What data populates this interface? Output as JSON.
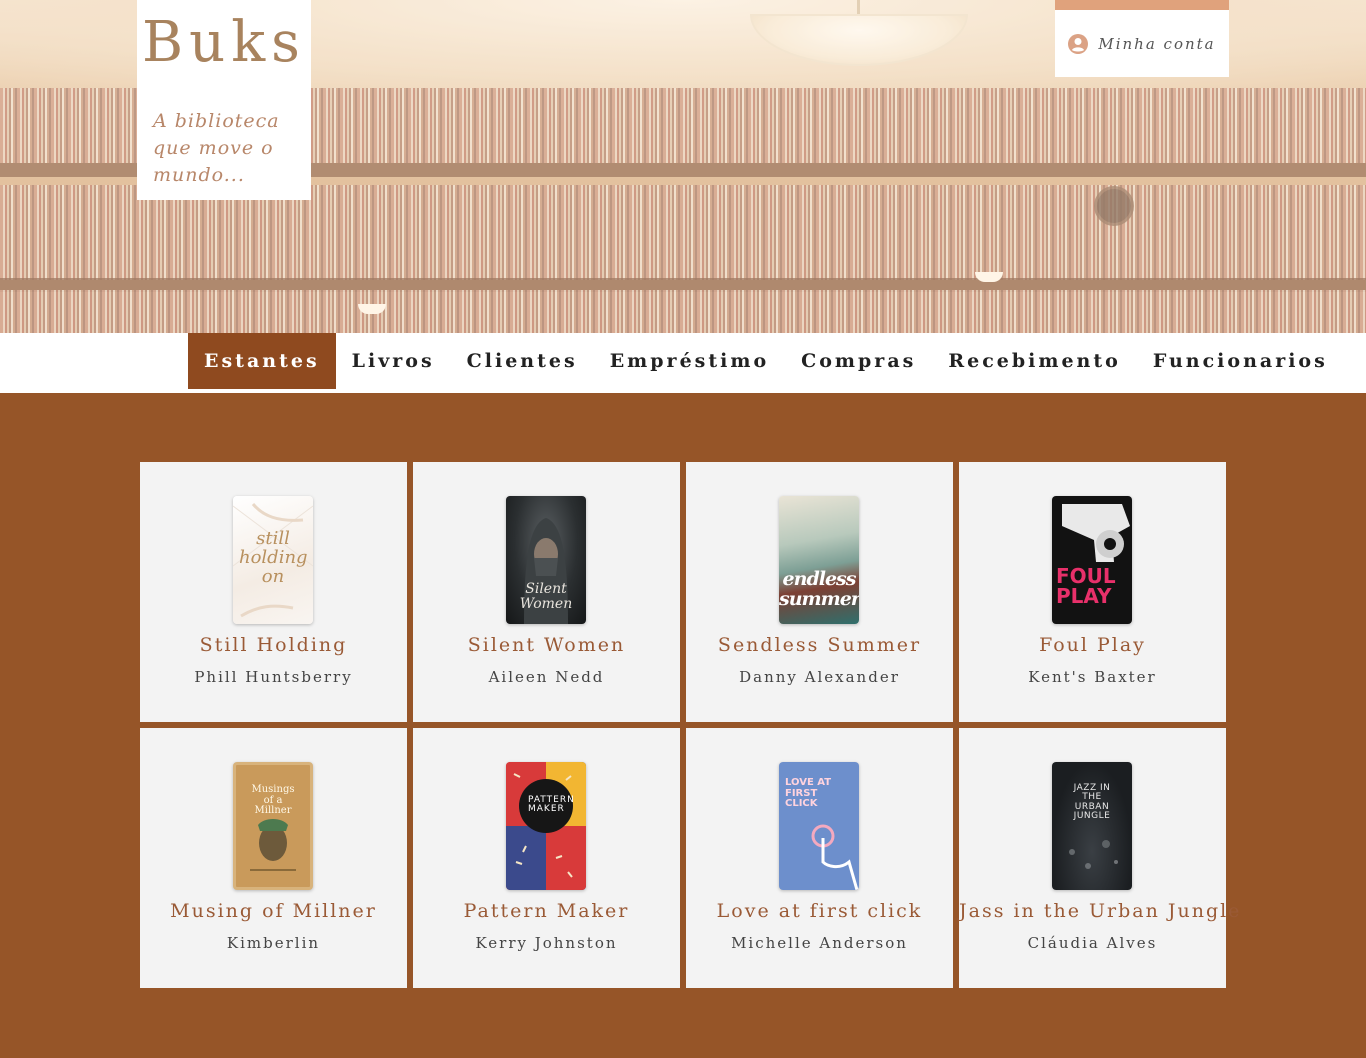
{
  "brand": {
    "name": "Buks",
    "tagline": "A biblioteca que move o mundo..."
  },
  "account": {
    "label": "Minha conta",
    "icon": "user-circle-icon"
  },
  "nav": {
    "items": [
      {
        "label": "Estantes",
        "active": true
      },
      {
        "label": "Livros",
        "active": false
      },
      {
        "label": "Clientes",
        "active": false
      },
      {
        "label": "Empréstimo",
        "active": false
      },
      {
        "label": "Compras",
        "active": false
      },
      {
        "label": "Recebimento",
        "active": false
      },
      {
        "label": "Funcionarios",
        "active": false
      }
    ]
  },
  "books": [
    {
      "title": "Still Holding",
      "author": "Phill Huntsberry",
      "cover_text": "still holding on"
    },
    {
      "title": "Silent Women",
      "author": "Aileen Nedd",
      "cover_text": "Silent Women"
    },
    {
      "title": "Sendless Summer",
      "author": "Danny Alexander",
      "cover_text": "endless summer"
    },
    {
      "title": "Foul Play",
      "author": "Kent's Baxter",
      "cover_text": "FOUL PLAY"
    },
    {
      "title": "Musing of Millner",
      "author": "Kimberlin",
      "cover_text": "Musings of a Millner"
    },
    {
      "title": "Pattern Maker",
      "author": "Kerry Johnston",
      "cover_text": "PATTERN MAKER"
    },
    {
      "title": "Love at first click",
      "author": "Michelle Anderson",
      "cover_text": "LOVE AT FIRST CLICK"
    },
    {
      "title": "Jass in the Urban Jungle",
      "author": "Cláudia Alves",
      "cover_text": "JAZZ IN THE URBAN JUNGLE"
    }
  ],
  "colors": {
    "page_background": "#965528",
    "nav_active": "#8f4a1f",
    "title_text": "#9a5a36",
    "card_background": "#f3f3f3",
    "account_accent": "#e0a27c"
  }
}
